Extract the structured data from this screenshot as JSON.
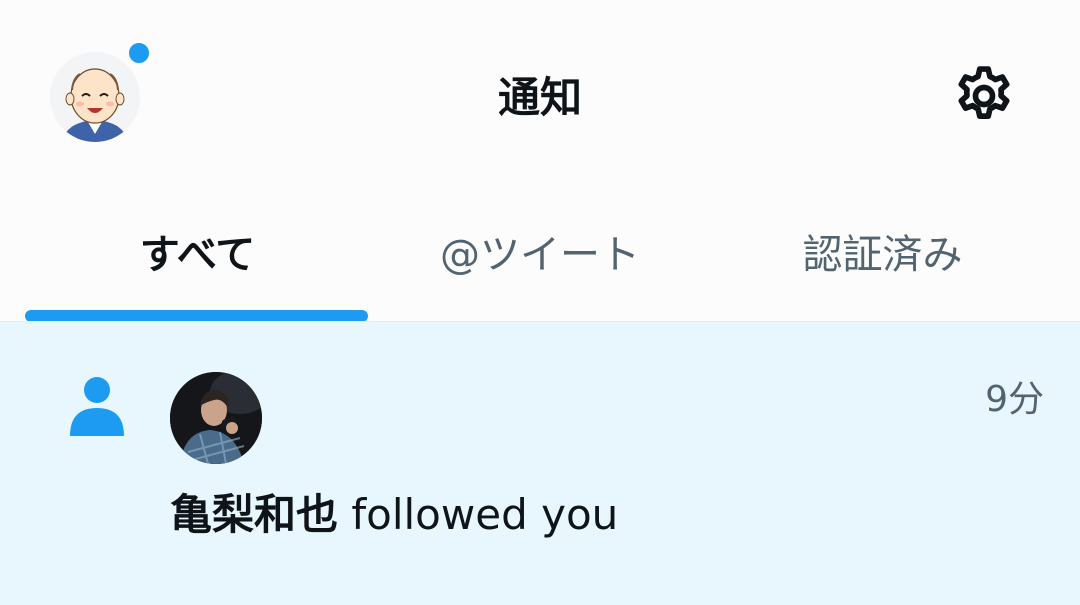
{
  "header": {
    "title": "通知",
    "avatar_icon": "profile-avatar-cartoon",
    "settings_icon": "gear-icon",
    "notification_dot_color": "#1d9bf0"
  },
  "tabs": [
    {
      "label": "すべて",
      "active": true
    },
    {
      "label": "@ツイート",
      "active": false
    },
    {
      "label": "認証済み",
      "active": false
    }
  ],
  "colors": {
    "accent": "#1d9bf0",
    "unread_background": "#e8f6fd",
    "secondary_text": "#536471"
  },
  "notifications": [
    {
      "type": "follow",
      "icon": "person-icon",
      "user_name": "亀梨和也",
      "action_text": " followed you",
      "time": "9分",
      "unread": true
    }
  ]
}
